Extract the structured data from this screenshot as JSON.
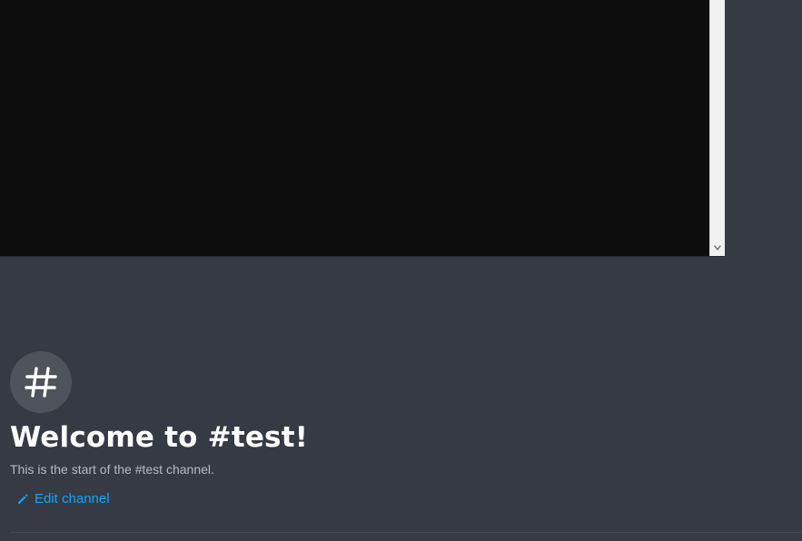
{
  "colors": {
    "background": "#363a44",
    "embedded_window": "#0d0d0e",
    "scrollbar": "#f0f0f0",
    "icon_circle": "#4f535b",
    "link": "#10a6ff",
    "title": "#ffffff",
    "subtitle": "#b7bac0"
  },
  "embedded_window": {
    "scroll_arrow_icon": "chevron-down-icon"
  },
  "welcome": {
    "channel_icon": "hash-icon",
    "title": "Welcome to #test!",
    "subtitle": "This is the start of the #test channel.",
    "edit_channel": {
      "icon": "pencil-icon",
      "label": "Edit channel"
    }
  }
}
